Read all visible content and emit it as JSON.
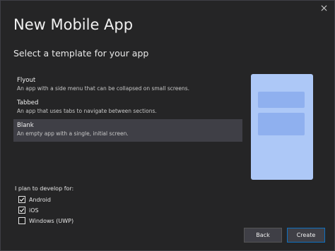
{
  "dialog": {
    "title": "New Mobile App",
    "subtitle": "Select a template for your app",
    "close_icon": "close-icon"
  },
  "templates": [
    {
      "name": "Flyout",
      "description": "An app with a side menu that can be collapsed on small screens.",
      "selected": false
    },
    {
      "name": "Tabbed",
      "description": "An app that uses tabs to navigate between sections.",
      "selected": false
    },
    {
      "name": "Blank",
      "description": "An empty app with a single, initial screen.",
      "selected": true
    }
  ],
  "preview": {
    "phone_color": "#adc8f7",
    "block_color": "#8fb0ef"
  },
  "platforms": {
    "label": "I plan to develop for:",
    "options": [
      {
        "label": "Android",
        "checked": true
      },
      {
        "label": "iOS",
        "checked": true
      },
      {
        "label": "Windows (UWP)",
        "checked": false
      }
    ]
  },
  "buttons": {
    "back": "Back",
    "create": "Create"
  },
  "colors": {
    "background": "#252526",
    "selected_item": "#3f3f46",
    "accent_border": "#0e70c0"
  }
}
